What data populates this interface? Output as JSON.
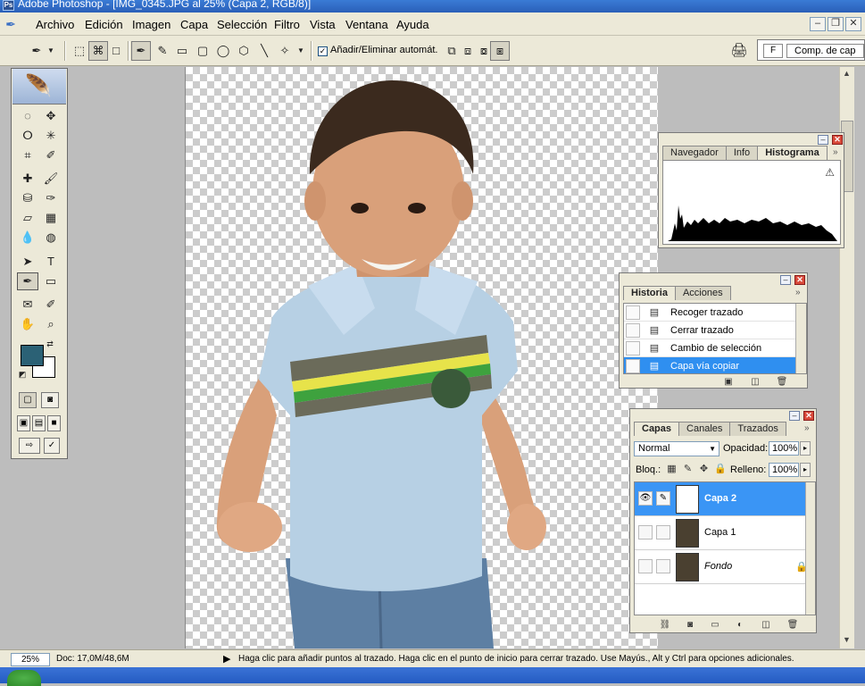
{
  "window": {
    "title": "Adobe Photoshop - [IMG_0345.JPG al 25% (Capa 2, RGB/8)]"
  },
  "menu": [
    "Archivo",
    "Edición",
    "Imagen",
    "Capa",
    "Selección",
    "Filtro",
    "Vista",
    "Ventana",
    "Ayuda"
  ],
  "options_bar": {
    "auto_add_delete_label": "Añadir/Eliminar automát.",
    "auto_add_delete_checked": true,
    "panel_well_tab1": "F",
    "panel_well_tab2": "Comp. de cap"
  },
  "histogram_panel": {
    "tabs": [
      "Navegador",
      "Info",
      "Histograma"
    ],
    "active_tab": "Histograma"
  },
  "history_panel": {
    "tabs": [
      "Historia",
      "Acciones"
    ],
    "active_tab": "Historia",
    "items": [
      {
        "label": "Recoger trazado",
        "selected": false
      },
      {
        "label": "Cerrar trazado",
        "selected": false
      },
      {
        "label": "Cambio de selección",
        "selected": false
      },
      {
        "label": "Capa vía copiar",
        "selected": true
      }
    ]
  },
  "layers_panel": {
    "tabs": [
      "Capas",
      "Canales",
      "Trazados"
    ],
    "active_tab": "Capas",
    "blend_mode": "Normal",
    "opacity_label": "Opacidad:",
    "opacity_value": "100%",
    "lock_label": "Bloq.:",
    "fill_label": "Relleno:",
    "fill_value": "100%",
    "layers": [
      {
        "name": "Capa 2",
        "selected": true,
        "visible": true,
        "locked": false
      },
      {
        "name": "Capa 1",
        "selected": false,
        "visible": false,
        "locked": false
      },
      {
        "name": "Fondo",
        "selected": false,
        "visible": false,
        "locked": true
      }
    ]
  },
  "status_bar": {
    "zoom": "25%",
    "doc_info": "Doc: 17,0M/48,6M",
    "hint": "Haga clic para añadir puntos al trazado. Haga clic en el punto de inicio para cerrar trazado. Use Mayús., Alt y Ctrl para opciones adicionales."
  },
  "colors": {
    "foreground": "#2b6175",
    "background": "#ffffff",
    "selection": "#3a95f5"
  },
  "icons": {
    "selection_marker": "✓"
  }
}
